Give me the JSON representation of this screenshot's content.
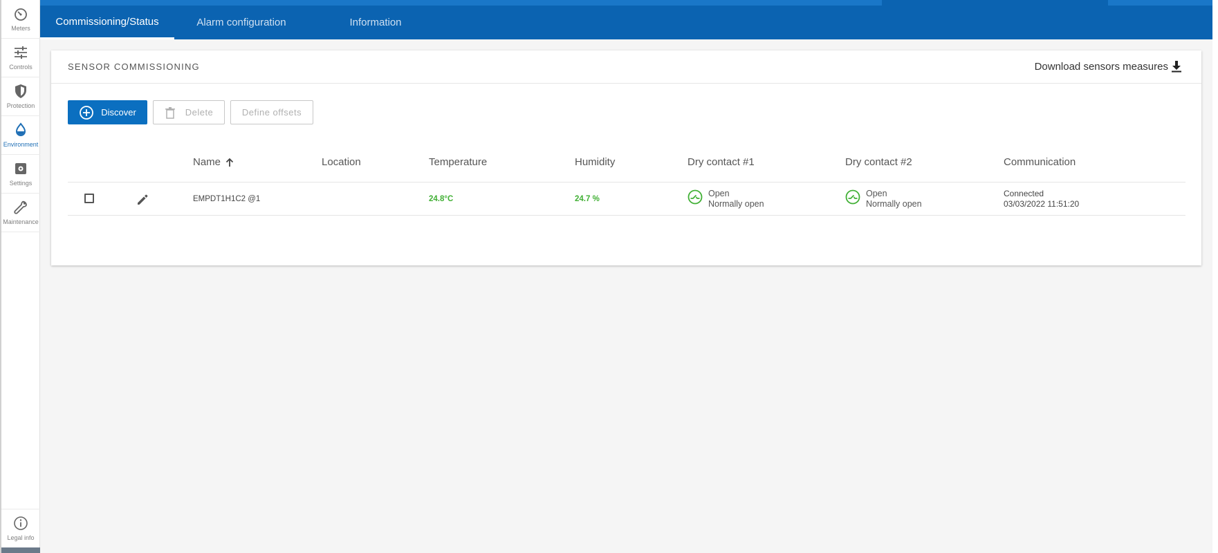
{
  "sidebar": {
    "items": [
      {
        "label": "Meters",
        "icon": "gauge-icon"
      },
      {
        "label": "Controls",
        "icon": "sliders-icon"
      },
      {
        "label": "Protection",
        "icon": "shield-icon"
      },
      {
        "label": "Environment",
        "icon": "drop-icon",
        "active": true
      },
      {
        "label": "Settings",
        "icon": "gear-icon"
      },
      {
        "label": "Maintenance",
        "icon": "wrench-icon"
      }
    ],
    "legal": {
      "label": "Legal info",
      "icon": "info-icon"
    }
  },
  "tabs": [
    {
      "label": "Commissioning/Status",
      "active": true
    },
    {
      "label": "Alarm configuration"
    },
    {
      "label": "Information"
    }
  ],
  "card": {
    "title": "SENSOR COMMISSIONING",
    "download_label": "Download sensors measures"
  },
  "toolbar": {
    "discover_label": "Discover",
    "delete_label": "Delete",
    "offsets_label": "Define offsets"
  },
  "table": {
    "columns": {
      "name": "Name",
      "location": "Location",
      "temperature": "Temperature",
      "humidity": "Humidity",
      "dry1": "Dry contact #1",
      "dry2": "Dry contact #2",
      "communication": "Communication"
    },
    "rows": [
      {
        "name": "EMPDT1H1C2 @1",
        "location": "",
        "temperature": "24.8°C",
        "humidity": "24.7 %",
        "dry1_state": "Open",
        "dry1_mode": "Normally open",
        "dry2_state": "Open",
        "dry2_mode": "Normally open",
        "comm_status": "Connected",
        "comm_time": "03/03/2022 11:51:20"
      }
    ]
  },
  "colors": {
    "brand": "#0b63b1",
    "primary_button": "#0b6fc0",
    "ok_green": "#41b035"
  }
}
